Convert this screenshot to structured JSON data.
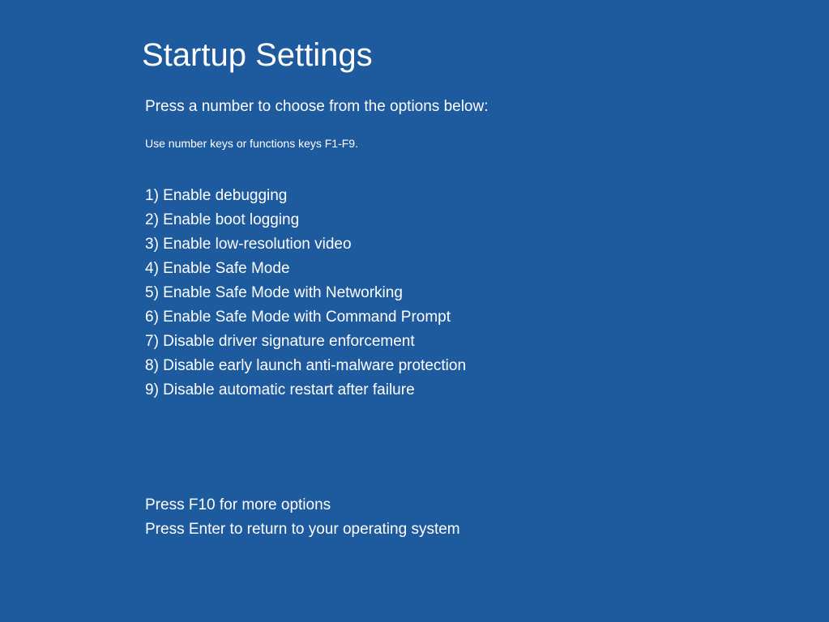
{
  "title": "Startup Settings",
  "instruction": "Press a number to choose from the options below:",
  "hint": "Use number keys or functions keys F1-F9.",
  "options": [
    "1) Enable debugging",
    "2) Enable boot logging",
    "3) Enable low-resolution video",
    "4) Enable Safe Mode",
    "5) Enable Safe Mode with Networking",
    "6) Enable Safe Mode with Command Prompt",
    "7) Disable driver signature enforcement",
    "8) Disable early launch anti-malware protection",
    "9) Disable automatic restart after failure"
  ],
  "footer": [
    "Press F10 for more options",
    "Press Enter to return to your operating system"
  ]
}
